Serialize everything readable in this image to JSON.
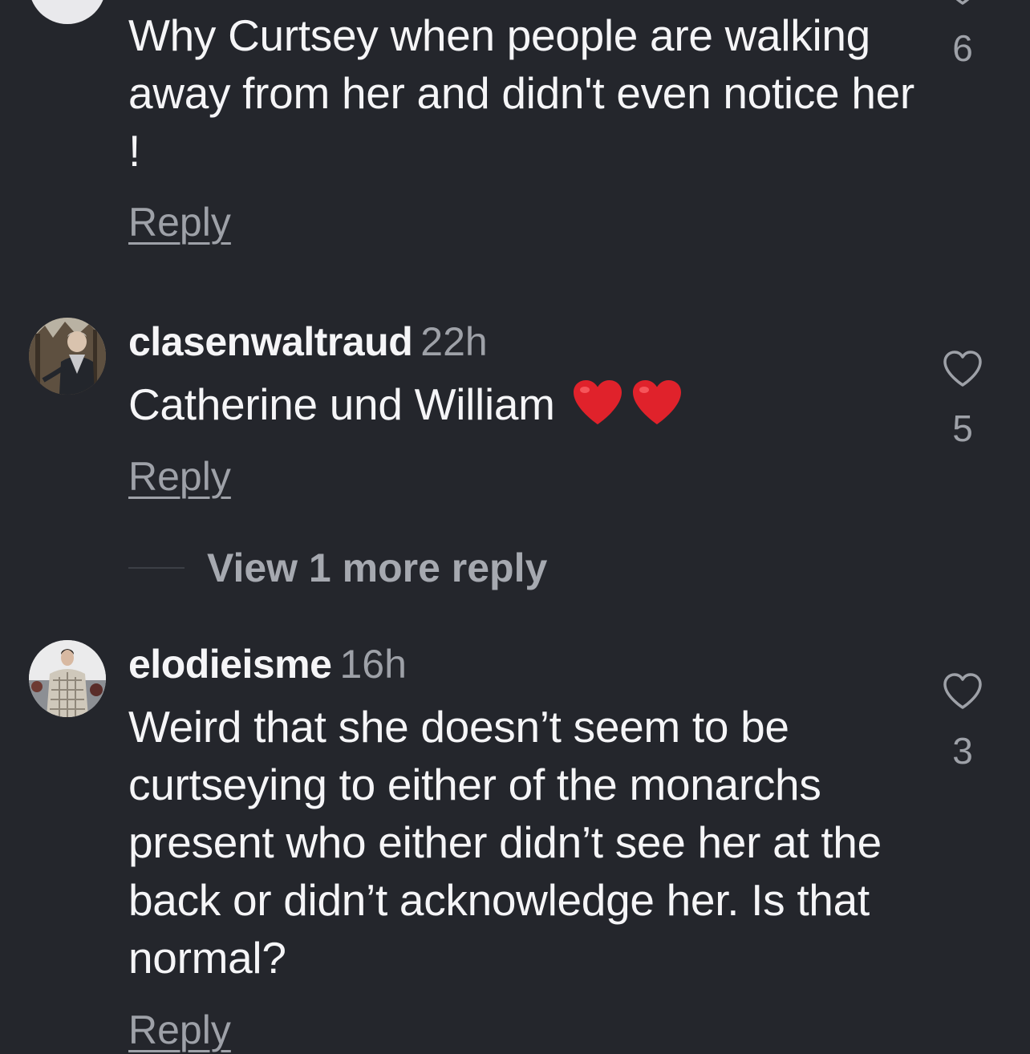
{
  "comments": [
    {
      "username": "",
      "time": "",
      "text": "Why Curtsey when people are walking away from her and didn't even notice her !",
      "reply_label": "Reply",
      "likes": "6"
    },
    {
      "username": "clasenwaltraud",
      "time": "22h",
      "text": "Catherine und William",
      "emojis": [
        "red-heart",
        "red-heart"
      ],
      "reply_label": "Reply",
      "likes": "5",
      "view_more_label": "View 1 more reply"
    },
    {
      "username": "elodieisme",
      "time": "16h",
      "text": "Weird that she doesn’t seem to be curtseying to either of the monarchs present who either didn’t see her at the back or didn’t acknowledge her. Is that normal?",
      "reply_label": "Reply",
      "likes": "3"
    }
  ],
  "colors": {
    "background": "#24262c",
    "primary_text": "#f5f5f7",
    "secondary_text": "#9ea1a8",
    "heart_emoji": "#e0222b"
  },
  "icons": {
    "like": "heart-outline-icon",
    "emoji": "red-heart-emoji"
  }
}
